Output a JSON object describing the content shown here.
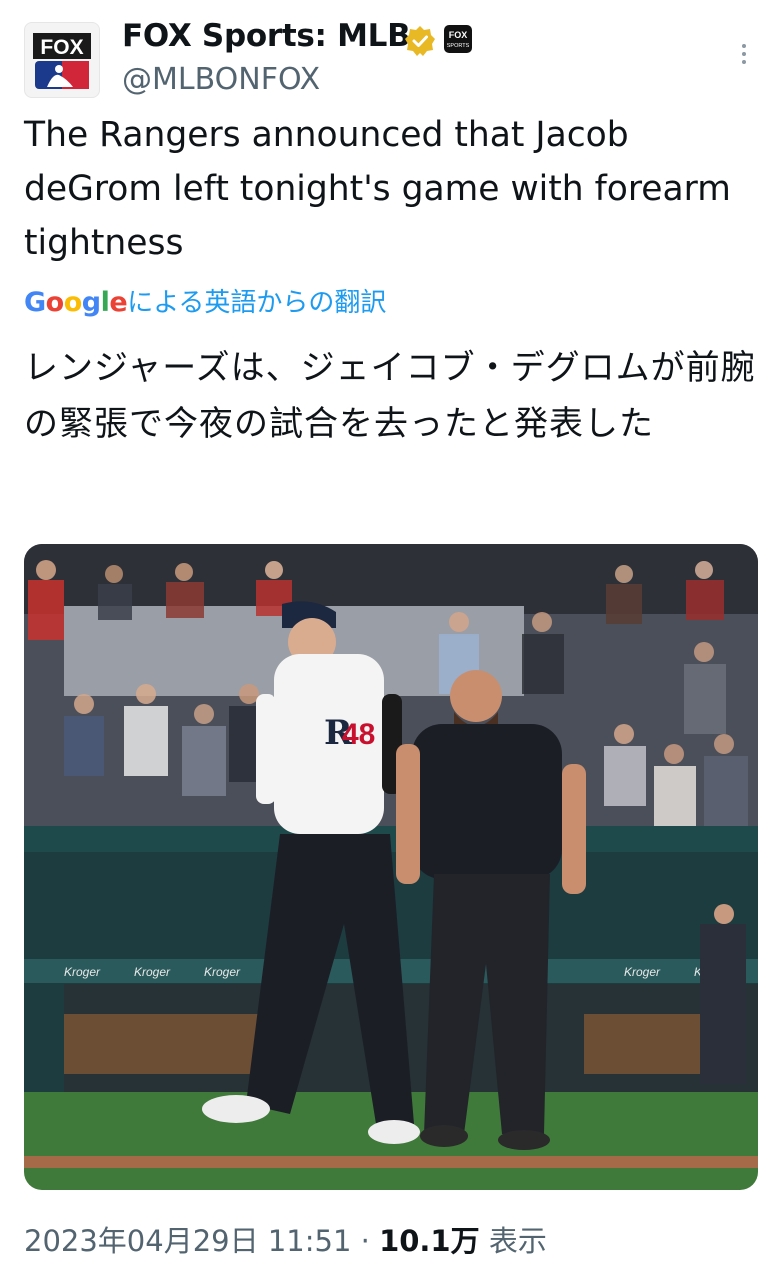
{
  "account": {
    "name": "FOX Sports: MLB",
    "handle": "@MLBONFOX",
    "avatar_text": "FOX",
    "affiliate_badge_text": "FOX SPORTS",
    "verified_color": "#e8b825"
  },
  "tweet": {
    "text": "The Rangers announced that Jacob deGrom left tonight's game with forearm tightness",
    "translated_by": "Google",
    "translate_label": "による英語からの翻訳",
    "translation": "レンジャーズは、ジェイコブ・デグロムが前腕の緊張で今夜の試合を去ったと発表した"
  },
  "media": {
    "pitcher_jersey_number": "48",
    "cap_logo": "R",
    "ad_board_text": "Kroger"
  },
  "meta": {
    "timestamp": "2023年04月29日 11:51",
    "separator": "·",
    "views": "10.1万",
    "views_label": "表示"
  },
  "icons": {
    "more": "more-vertical-icon",
    "verified": "verified-badge-icon"
  }
}
